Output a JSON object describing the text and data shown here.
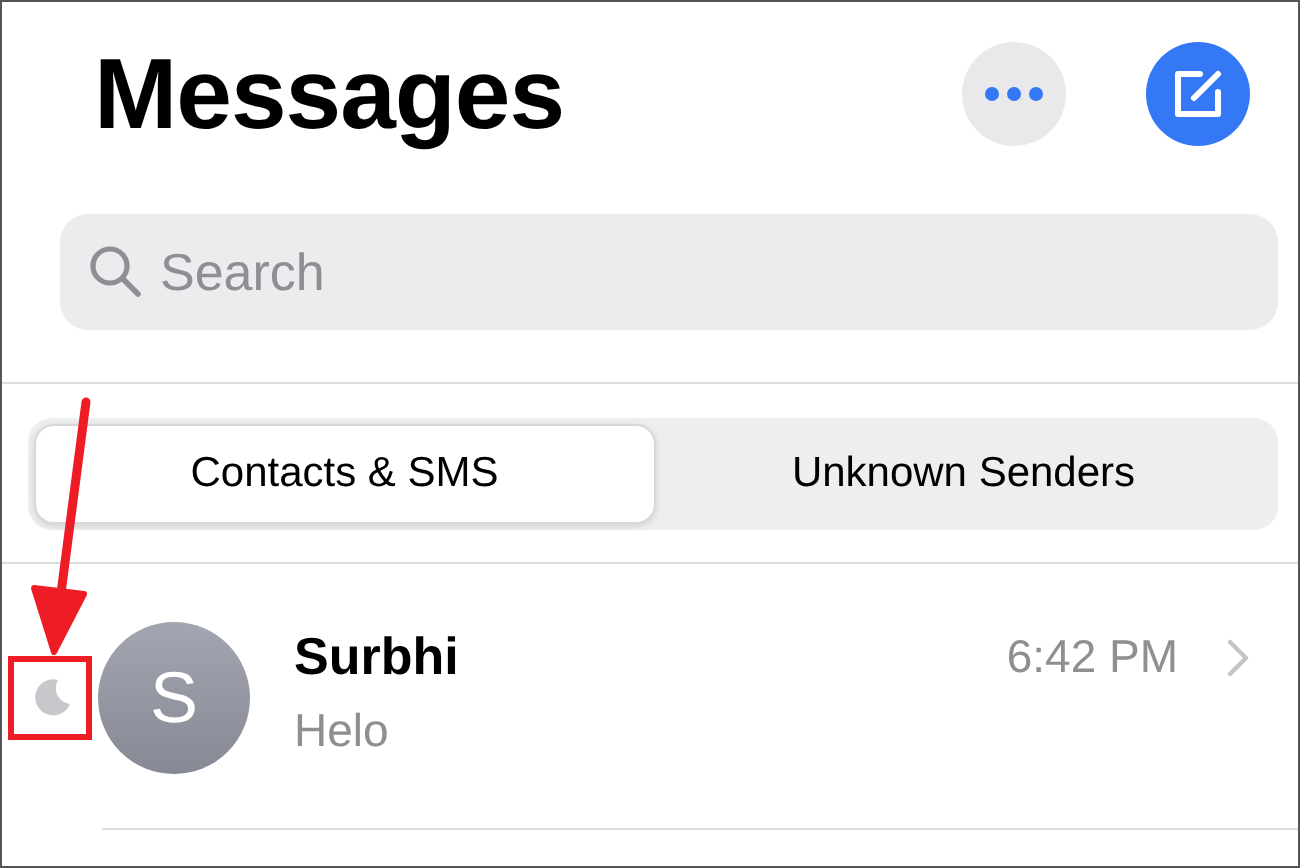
{
  "header": {
    "title": "Messages"
  },
  "search": {
    "placeholder": "Search"
  },
  "filter_tabs": [
    {
      "label": "Contacts & SMS",
      "selected": true
    },
    {
      "label": "Unknown Senders",
      "selected": false
    }
  ],
  "conversations": [
    {
      "initial": "S",
      "name": "Surbhi",
      "preview": "Helo",
      "time": "6:42 PM",
      "muted": true
    }
  ],
  "callout": {
    "kind": "arrow-box"
  }
}
